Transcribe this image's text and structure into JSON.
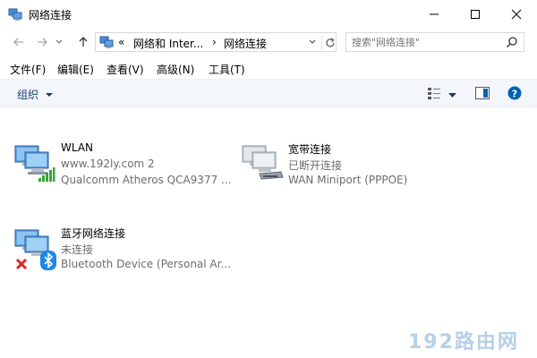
{
  "window": {
    "title": "网络连接"
  },
  "address": {
    "overflow": "«",
    "crumbs": [
      "网络和 Inter...",
      "网络连接"
    ]
  },
  "search": {
    "placeholder": "搜索\"网络连接\""
  },
  "menu": [
    {
      "label": "文件(F)"
    },
    {
      "label": "编辑(E)"
    },
    {
      "label": "查看(V)"
    },
    {
      "label": "高级(N)"
    },
    {
      "label": "工具(T)"
    }
  ],
  "toolbar": {
    "organize_label": "组织"
  },
  "connections": [
    {
      "name": "WLAN",
      "status": "www.192ly.com 2",
      "device": "Qualcomm Atheros QCA9377 ..."
    },
    {
      "name": "宽带连接",
      "status": "已断开连接",
      "device": "WAN Miniport (PPPOE)"
    },
    {
      "name": "蓝牙网络连接",
      "status": "未连接",
      "device": "Bluetooth Device (Personal Ar..."
    }
  ],
  "watermark": "192路由网",
  "colors": {
    "accent": "#0063b1",
    "signal_green": "#3aa63a",
    "error_red": "#d42a2a",
    "bluetooth": "#1e88e5"
  }
}
